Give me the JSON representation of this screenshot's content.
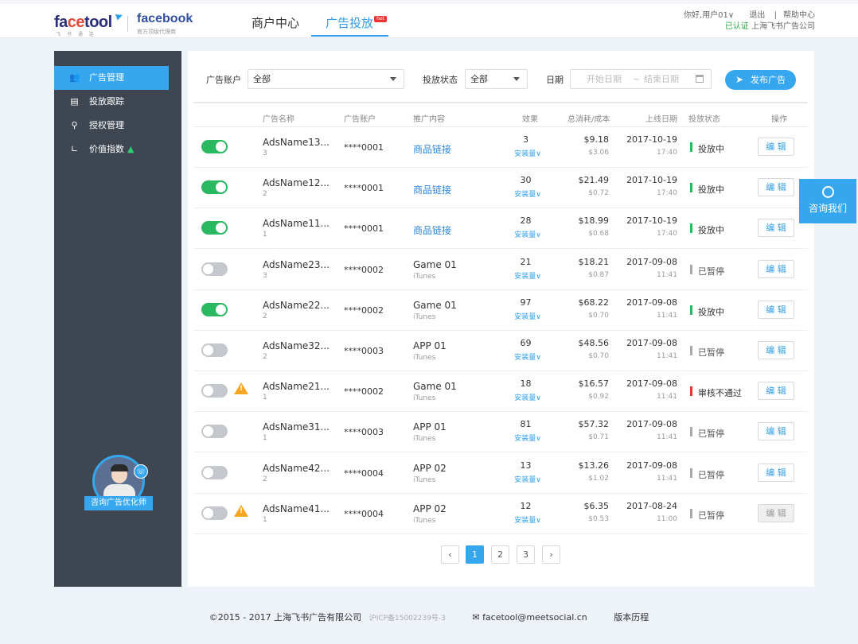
{
  "brand": {
    "logo_fa": "fa",
    "logo_ce": "ce",
    "logo_tool": "tool",
    "logo_sub": "飞 书 通 连",
    "partner": "facebook",
    "partner_sub": "官方顶级代理商"
  },
  "nav": {
    "merchant": "商户中心",
    "ads": "广告投放",
    "hot": "hot"
  },
  "user": {
    "greeting": "你好,",
    "name": "用户01",
    "dropdown": "∨",
    "logout": "退出",
    "divider": "|",
    "help": "帮助中心",
    "verified": "已认证",
    "company": "上海飞书广告公司"
  },
  "sidebar": {
    "items": [
      {
        "label": "广告管理",
        "icon": "users-icon"
      },
      {
        "label": "投放跟踪",
        "icon": "document-icon"
      },
      {
        "label": "授权管理",
        "icon": "key-icon"
      },
      {
        "label": "价值指数",
        "icon": "chart-icon"
      }
    ],
    "advisor_label": "咨询广告优化师"
  },
  "filters": {
    "account_label": "广告账户",
    "account_value": "全部",
    "status_label": "投放状态",
    "status_value": "全部",
    "date_label": "日期",
    "date_start": "开始日期",
    "date_to": "~",
    "date_end": "结束日期",
    "publish": "发布广告"
  },
  "table": {
    "headers": [
      "广告名称",
      "广告账户",
      "推广内容",
      "效果",
      "总消耗/成本",
      "上线日期",
      "投放状态",
      "操作"
    ],
    "rows": [
      {
        "on": true,
        "warn": false,
        "name": "AdsName13...",
        "id": "3",
        "acct": "****0001",
        "content": "商品链接",
        "content_sub": "",
        "link": true,
        "effect": "3",
        "effect_sub": "安装量∨",
        "cost": "$9.18",
        "cost_sub": "$3.06",
        "date": "2017-10-19",
        "time": "17:40",
        "status": "投放中",
        "status_color": "green",
        "edit": "编 辑",
        "edit_disabled": false
      },
      {
        "on": true,
        "warn": false,
        "name": "AdsName12...",
        "id": "2",
        "acct": "****0001",
        "content": "商品链接",
        "content_sub": "",
        "link": true,
        "effect": "30",
        "effect_sub": "安装量∨",
        "cost": "$21.49",
        "cost_sub": "$0.72",
        "date": "2017-10-19",
        "time": "17:40",
        "status": "投放中",
        "status_color": "green",
        "edit": "编 辑",
        "edit_disabled": false
      },
      {
        "on": true,
        "warn": false,
        "name": "AdsName11...",
        "id": "1",
        "acct": "****0001",
        "content": "商品链接",
        "content_sub": "",
        "link": true,
        "effect": "28",
        "effect_sub": "安装量∨",
        "cost": "$18.99",
        "cost_sub": "$0.68",
        "date": "2017-10-19",
        "time": "17:40",
        "status": "投放中",
        "status_color": "green",
        "edit": "编 辑",
        "edit_disabled": false
      },
      {
        "on": false,
        "warn": false,
        "name": "AdsName23...",
        "id": "3",
        "acct": "****0002",
        "content": "Game 01",
        "content_sub": "iTunes",
        "link": false,
        "effect": "21",
        "effect_sub": "安装量∨",
        "cost": "$18.21",
        "cost_sub": "$0.87",
        "date": "2017-09-08",
        "time": "11:41",
        "status": "已暂停",
        "status_color": "grey",
        "edit": "编 辑",
        "edit_disabled": false
      },
      {
        "on": true,
        "warn": false,
        "name": "AdsName22...",
        "id": "2",
        "acct": "****0002",
        "content": "Game 01",
        "content_sub": "iTunes",
        "link": false,
        "effect": "97",
        "effect_sub": "安装量∨",
        "cost": "$68.22",
        "cost_sub": "$0.70",
        "date": "2017-09-08",
        "time": "11:41",
        "status": "投放中",
        "status_color": "green",
        "edit": "编 辑",
        "edit_disabled": false
      },
      {
        "on": false,
        "warn": false,
        "name": "AdsName32...",
        "id": "2",
        "acct": "****0003",
        "content": "APP 01",
        "content_sub": "iTunes",
        "link": false,
        "effect": "69",
        "effect_sub": "安装量∨",
        "cost": "$48.56",
        "cost_sub": "$0.70",
        "date": "2017-09-08",
        "time": "11:41",
        "status": "已暂停",
        "status_color": "grey",
        "edit": "编 辑",
        "edit_disabled": false
      },
      {
        "on": false,
        "warn": true,
        "name": "AdsName21...",
        "id": "1",
        "acct": "****0002",
        "content": "Game 01",
        "content_sub": "iTunes",
        "link": false,
        "effect": "18",
        "effect_sub": "安装量∨",
        "cost": "$16.57",
        "cost_sub": "$0.92",
        "date": "2017-09-08",
        "time": "11:41",
        "status": "审核不通过",
        "status_color": "red",
        "edit": "编 辑",
        "edit_disabled": false
      },
      {
        "on": false,
        "warn": false,
        "name": "AdsName31...",
        "id": "1",
        "acct": "****0003",
        "content": "APP 01",
        "content_sub": "iTunes",
        "link": false,
        "effect": "81",
        "effect_sub": "安装量∨",
        "cost": "$57.32",
        "cost_sub": "$0.71",
        "date": "2017-09-08",
        "time": "11:41",
        "status": "已暂停",
        "status_color": "grey",
        "edit": "编 辑",
        "edit_disabled": false
      },
      {
        "on": false,
        "warn": false,
        "name": "AdsName42...",
        "id": "2",
        "acct": "****0004",
        "content": "APP 02",
        "content_sub": "iTunes",
        "link": false,
        "effect": "13",
        "effect_sub": "安装量∨",
        "cost": "$13.26",
        "cost_sub": "$1.02",
        "date": "2017-09-08",
        "time": "11:41",
        "status": "已暂停",
        "status_color": "grey",
        "edit": "编 辑",
        "edit_disabled": false
      },
      {
        "on": false,
        "warn": true,
        "name": "AdsName41...",
        "id": "1",
        "acct": "****0004",
        "content": "APP 02",
        "content_sub": "iTunes",
        "link": false,
        "effect": "12",
        "effect_sub": "安装量∨",
        "cost": "$6.35",
        "cost_sub": "$0.53",
        "date": "2017-08-24",
        "time": "11:00",
        "status": "已暂停",
        "status_color": "grey",
        "edit": "编 辑",
        "edit_disabled": true
      }
    ]
  },
  "pagination": {
    "prev": "‹",
    "pages": [
      "1",
      "2",
      "3"
    ],
    "current": "1",
    "next": "›"
  },
  "float_contact": "咨询我们",
  "footer": {
    "copyright": "©2015 - 2017 上海飞书广告有限公司",
    "icp": "沪ICP备15002239号-3",
    "email": "facetool@meetsocial.cn",
    "version": "版本历程"
  },
  "colors": {
    "accent": "#36a7ef",
    "sidebar": "#3e4652",
    "toggle_on": "#2ab861",
    "status_red": "#e8352f",
    "warning": "#f5a623"
  }
}
